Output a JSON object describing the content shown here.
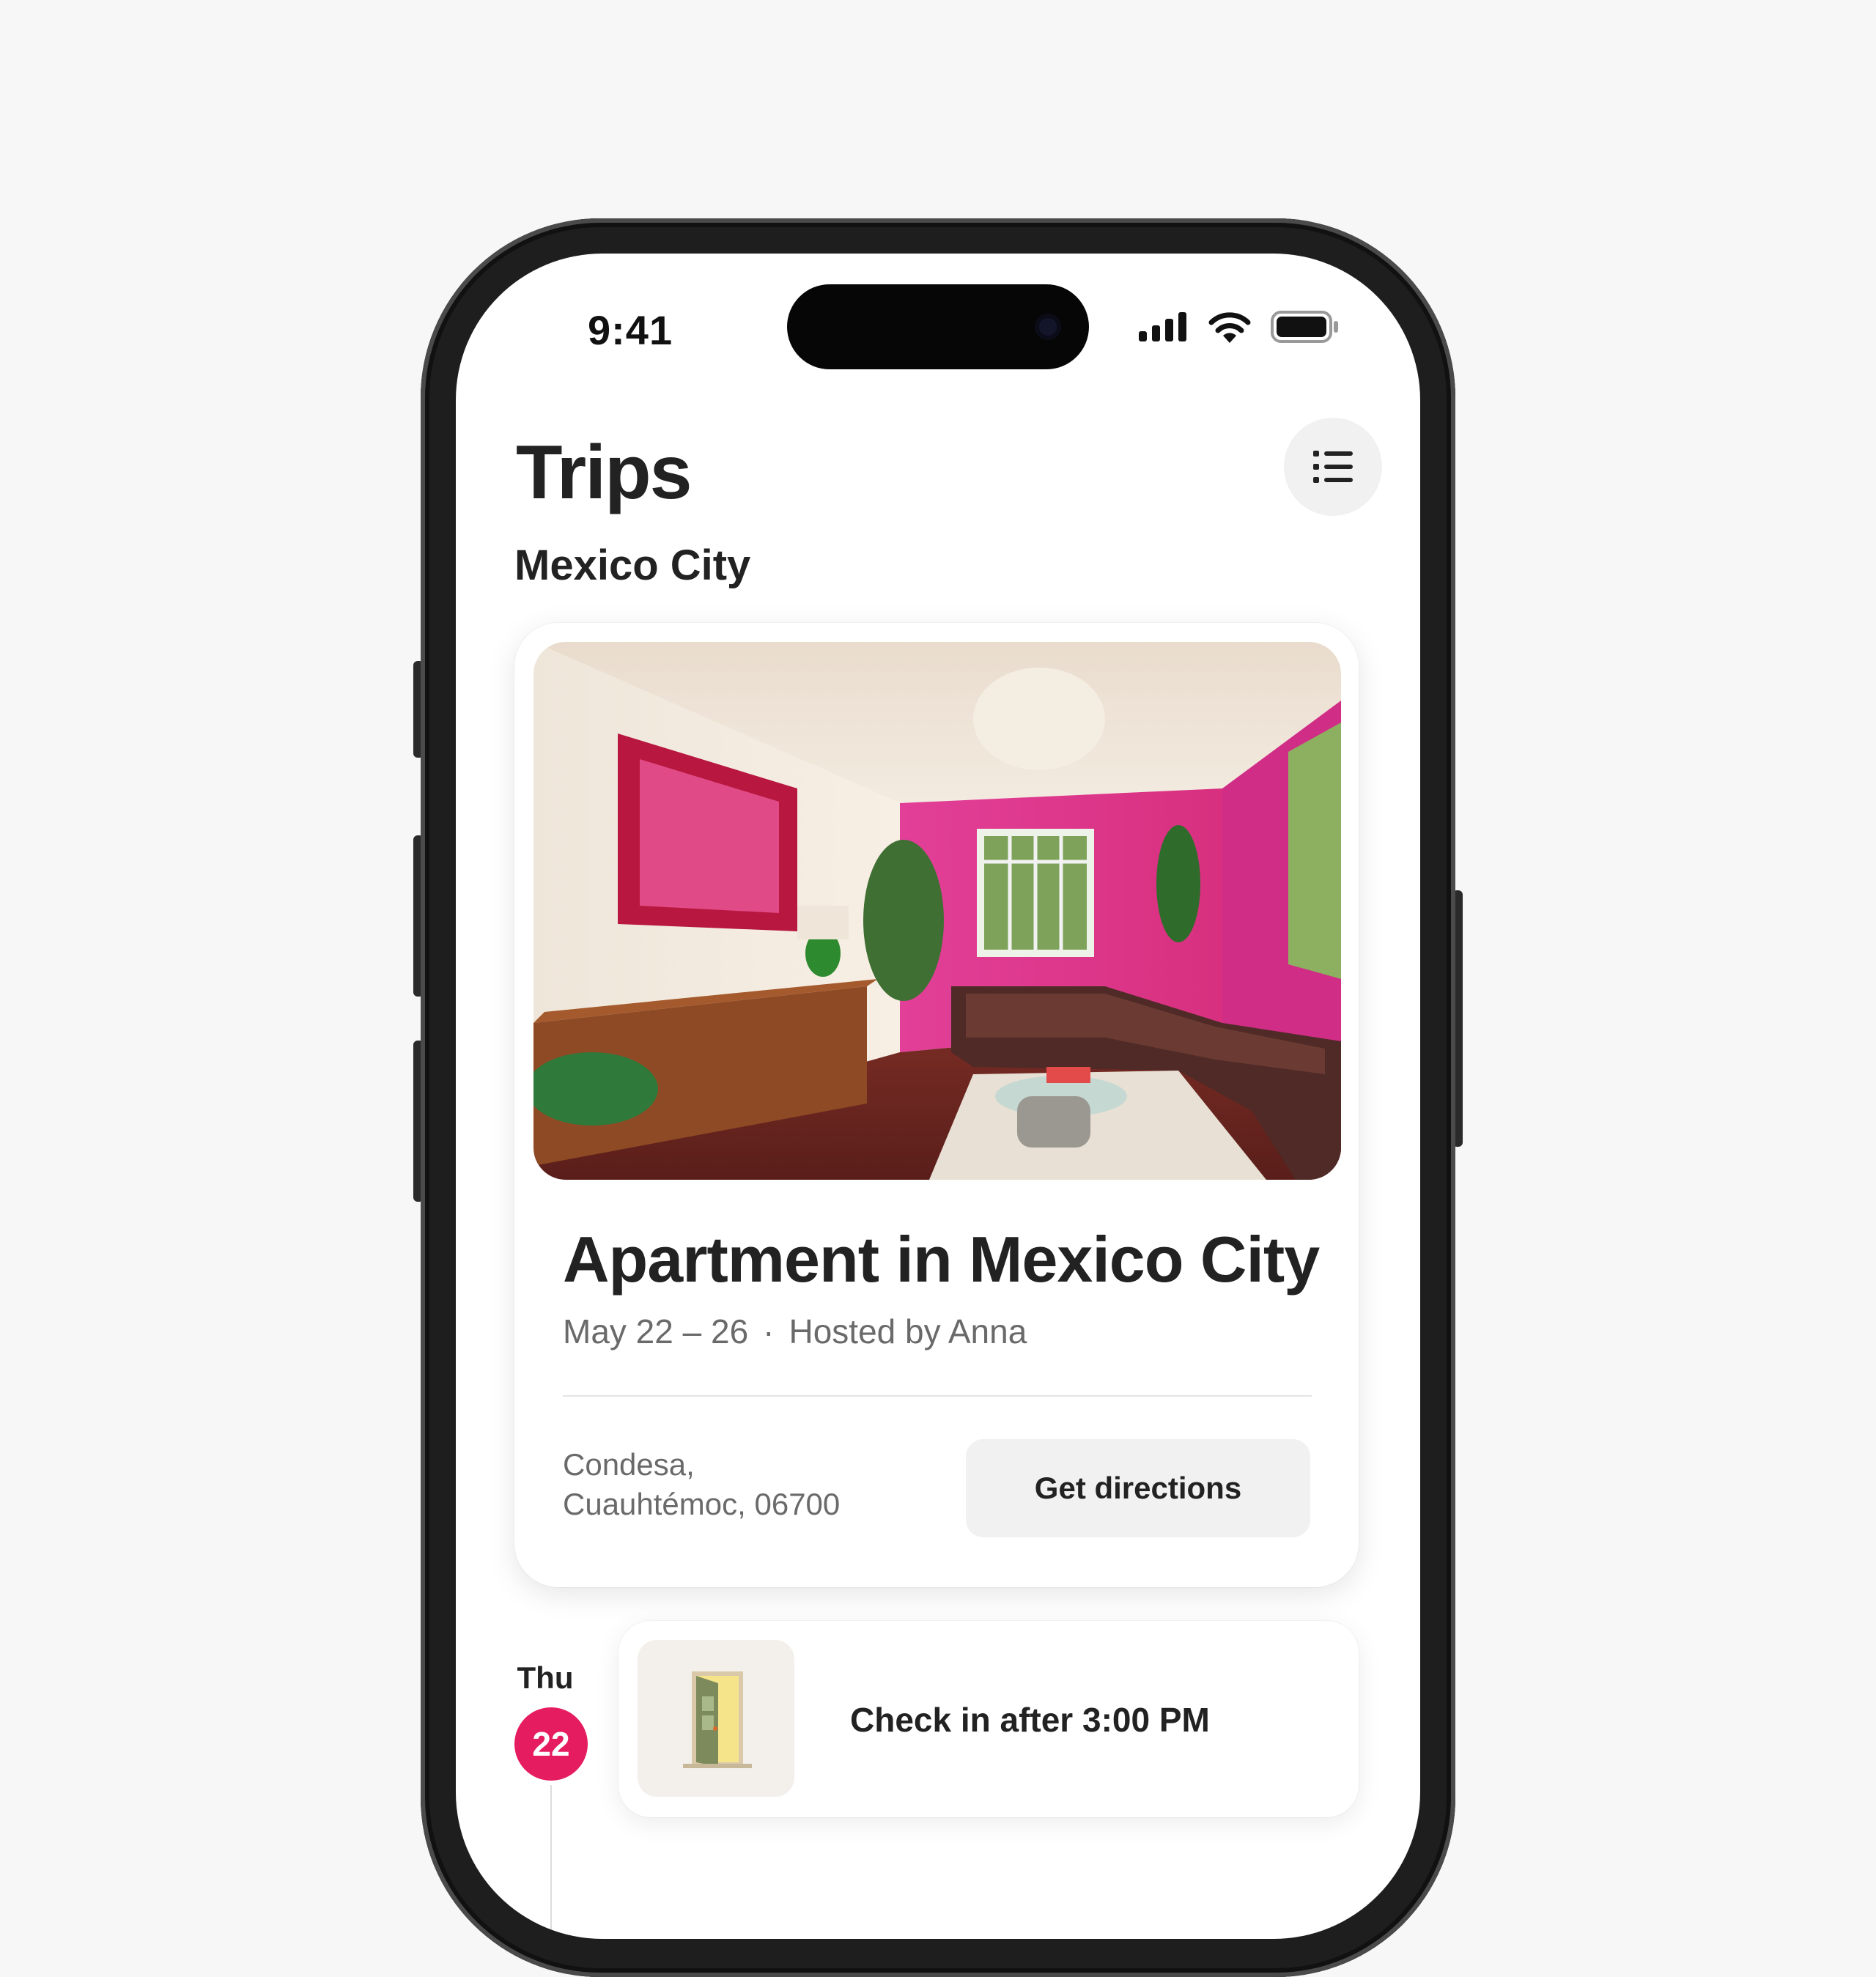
{
  "status_bar": {
    "time": "9:41",
    "icons": [
      "cellular-signal-icon",
      "wifi-icon",
      "battery-icon"
    ]
  },
  "header": {
    "title": "Trips",
    "menu_icon": "list-icon"
  },
  "section": {
    "city": "Mexico City"
  },
  "reservation": {
    "photo": "living-room-photo",
    "title": "Apartment in Mexico City",
    "dates": "May 22 – 26",
    "separator": "·",
    "host": "Hosted by Anna",
    "address_line1": "Condesa,",
    "address_line2": "Cuauhtémoc, 06700",
    "directions_label": "Get directions"
  },
  "itinerary": {
    "day_name": "Thu",
    "day_number": "22",
    "event_icon": "open-door-icon",
    "event_text": "Check in after 3:00 PM"
  },
  "colors": {
    "accent": "#e51d60",
    "text_primary": "#222222",
    "text_secondary": "#6a6a6a",
    "page_background": "#f7f7f7"
  }
}
